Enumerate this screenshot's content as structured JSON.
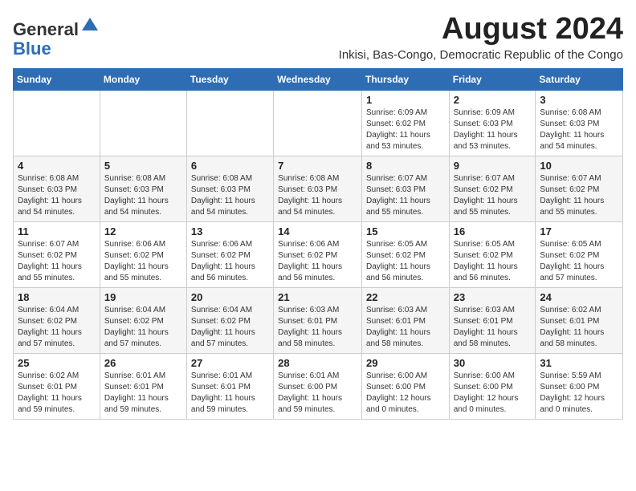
{
  "logo": {
    "general": "General",
    "blue": "Blue"
  },
  "title": "August 2024",
  "subtitle": "Inkisi, Bas-Congo, Democratic Republic of the Congo",
  "days_of_week": [
    "Sunday",
    "Monday",
    "Tuesday",
    "Wednesday",
    "Thursday",
    "Friday",
    "Saturday"
  ],
  "weeks": [
    [
      {
        "day": "",
        "info": ""
      },
      {
        "day": "",
        "info": ""
      },
      {
        "day": "",
        "info": ""
      },
      {
        "day": "",
        "info": ""
      },
      {
        "day": "1",
        "info": "Sunrise: 6:09 AM\nSunset: 6:02 PM\nDaylight: 11 hours\nand 53 minutes."
      },
      {
        "day": "2",
        "info": "Sunrise: 6:09 AM\nSunset: 6:03 PM\nDaylight: 11 hours\nand 53 minutes."
      },
      {
        "day": "3",
        "info": "Sunrise: 6:08 AM\nSunset: 6:03 PM\nDaylight: 11 hours\nand 54 minutes."
      }
    ],
    [
      {
        "day": "4",
        "info": "Sunrise: 6:08 AM\nSunset: 6:03 PM\nDaylight: 11 hours\nand 54 minutes."
      },
      {
        "day": "5",
        "info": "Sunrise: 6:08 AM\nSunset: 6:03 PM\nDaylight: 11 hours\nand 54 minutes."
      },
      {
        "day": "6",
        "info": "Sunrise: 6:08 AM\nSunset: 6:03 PM\nDaylight: 11 hours\nand 54 minutes."
      },
      {
        "day": "7",
        "info": "Sunrise: 6:08 AM\nSunset: 6:03 PM\nDaylight: 11 hours\nand 54 minutes."
      },
      {
        "day": "8",
        "info": "Sunrise: 6:07 AM\nSunset: 6:03 PM\nDaylight: 11 hours\nand 55 minutes."
      },
      {
        "day": "9",
        "info": "Sunrise: 6:07 AM\nSunset: 6:02 PM\nDaylight: 11 hours\nand 55 minutes."
      },
      {
        "day": "10",
        "info": "Sunrise: 6:07 AM\nSunset: 6:02 PM\nDaylight: 11 hours\nand 55 minutes."
      }
    ],
    [
      {
        "day": "11",
        "info": "Sunrise: 6:07 AM\nSunset: 6:02 PM\nDaylight: 11 hours\nand 55 minutes."
      },
      {
        "day": "12",
        "info": "Sunrise: 6:06 AM\nSunset: 6:02 PM\nDaylight: 11 hours\nand 55 minutes."
      },
      {
        "day": "13",
        "info": "Sunrise: 6:06 AM\nSunset: 6:02 PM\nDaylight: 11 hours\nand 56 minutes."
      },
      {
        "day": "14",
        "info": "Sunrise: 6:06 AM\nSunset: 6:02 PM\nDaylight: 11 hours\nand 56 minutes."
      },
      {
        "day": "15",
        "info": "Sunrise: 6:05 AM\nSunset: 6:02 PM\nDaylight: 11 hours\nand 56 minutes."
      },
      {
        "day": "16",
        "info": "Sunrise: 6:05 AM\nSunset: 6:02 PM\nDaylight: 11 hours\nand 56 minutes."
      },
      {
        "day": "17",
        "info": "Sunrise: 6:05 AM\nSunset: 6:02 PM\nDaylight: 11 hours\nand 57 minutes."
      }
    ],
    [
      {
        "day": "18",
        "info": "Sunrise: 6:04 AM\nSunset: 6:02 PM\nDaylight: 11 hours\nand 57 minutes."
      },
      {
        "day": "19",
        "info": "Sunrise: 6:04 AM\nSunset: 6:02 PM\nDaylight: 11 hours\nand 57 minutes."
      },
      {
        "day": "20",
        "info": "Sunrise: 6:04 AM\nSunset: 6:02 PM\nDaylight: 11 hours\nand 57 minutes."
      },
      {
        "day": "21",
        "info": "Sunrise: 6:03 AM\nSunset: 6:01 PM\nDaylight: 11 hours\nand 58 minutes."
      },
      {
        "day": "22",
        "info": "Sunrise: 6:03 AM\nSunset: 6:01 PM\nDaylight: 11 hours\nand 58 minutes."
      },
      {
        "day": "23",
        "info": "Sunrise: 6:03 AM\nSunset: 6:01 PM\nDaylight: 11 hours\nand 58 minutes."
      },
      {
        "day": "24",
        "info": "Sunrise: 6:02 AM\nSunset: 6:01 PM\nDaylight: 11 hours\nand 58 minutes."
      }
    ],
    [
      {
        "day": "25",
        "info": "Sunrise: 6:02 AM\nSunset: 6:01 PM\nDaylight: 11 hours\nand 59 minutes."
      },
      {
        "day": "26",
        "info": "Sunrise: 6:01 AM\nSunset: 6:01 PM\nDaylight: 11 hours\nand 59 minutes."
      },
      {
        "day": "27",
        "info": "Sunrise: 6:01 AM\nSunset: 6:01 PM\nDaylight: 11 hours\nand 59 minutes."
      },
      {
        "day": "28",
        "info": "Sunrise: 6:01 AM\nSunset: 6:00 PM\nDaylight: 11 hours\nand 59 minutes."
      },
      {
        "day": "29",
        "info": "Sunrise: 6:00 AM\nSunset: 6:00 PM\nDaylight: 12 hours\nand 0 minutes."
      },
      {
        "day": "30",
        "info": "Sunrise: 6:00 AM\nSunset: 6:00 PM\nDaylight: 12 hours\nand 0 minutes."
      },
      {
        "day": "31",
        "info": "Sunrise: 5:59 AM\nSunset: 6:00 PM\nDaylight: 12 hours\nand 0 minutes."
      }
    ]
  ]
}
